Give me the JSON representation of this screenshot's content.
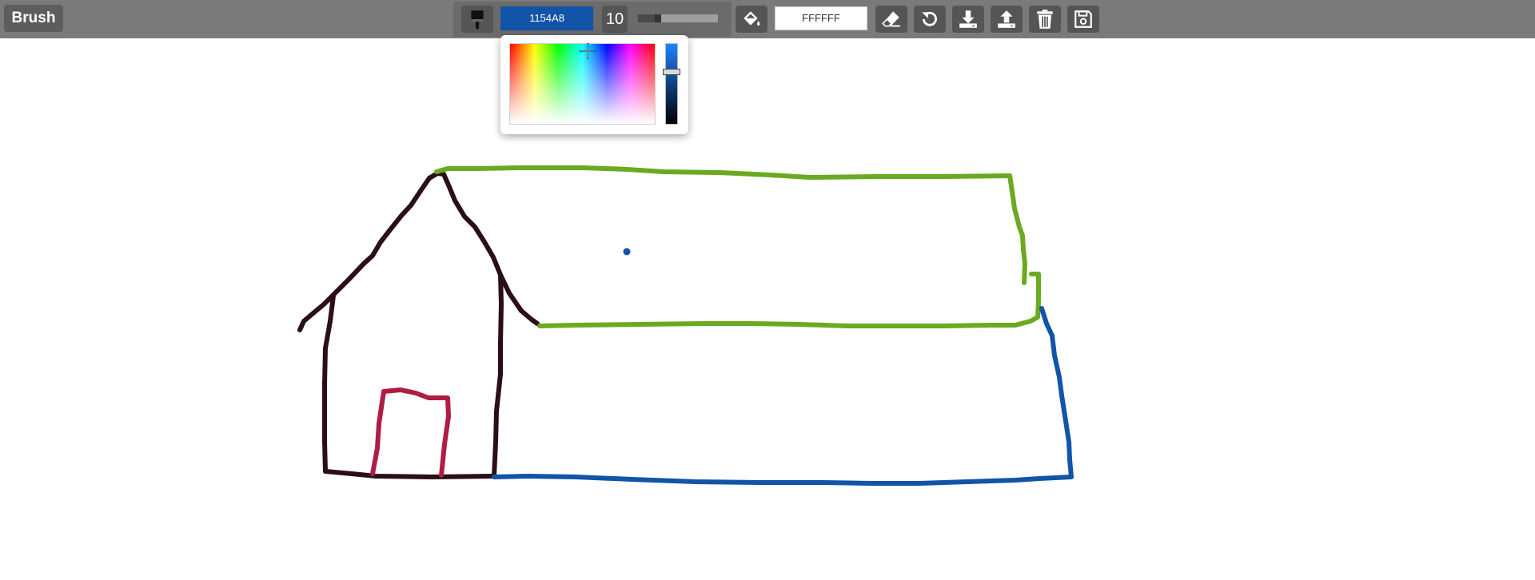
{
  "toolbar": {
    "mode_label": "Brush",
    "brush_icon": "paint-brush-icon",
    "brush_color": "1154A8",
    "brush_size": "10",
    "size_slider_value": 10,
    "size_slider_max": 100,
    "fill_icon": "paint-bucket-icon",
    "background_color": "FFFFFF",
    "buttons": [
      {
        "icon": "eraser-icon"
      },
      {
        "icon": "undo-icon"
      },
      {
        "icon": "download-icon"
      },
      {
        "icon": "upload-icon"
      },
      {
        "icon": "trash-icon"
      },
      {
        "icon": "save-icon"
      }
    ]
  },
  "color_picker": {
    "open": true,
    "value_level": 0.35
  },
  "colors": {
    "toolbar_bg": "#7a7a7a",
    "button_bg": "#555555",
    "brush_color": "#1154A8",
    "stroke_dark": "#2a0f17",
    "stroke_green": "#6aaa20",
    "stroke_blue": "#1154A8",
    "stroke_red": "#b01c44"
  }
}
